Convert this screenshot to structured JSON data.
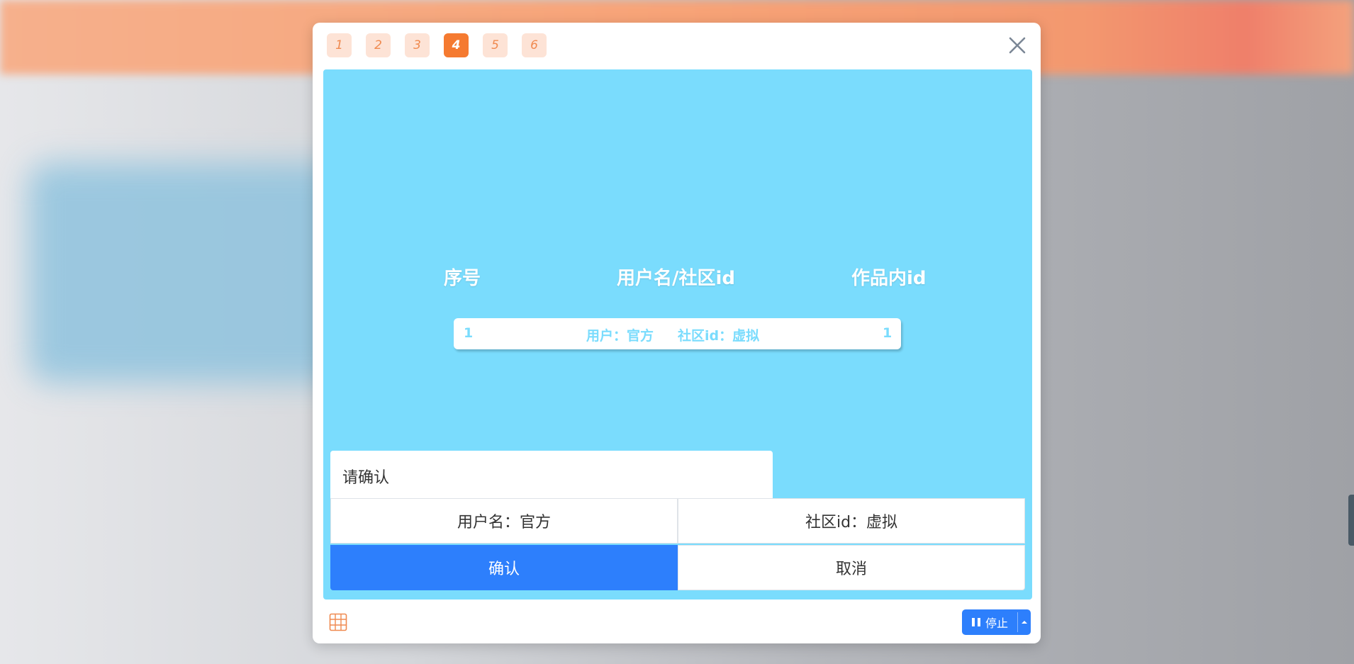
{
  "page_tabs": [
    "1",
    "2",
    "3",
    "4",
    "5",
    "6"
  ],
  "active_tab": "4",
  "table": {
    "headers": [
      "序号",
      "用户名/社区id",
      "作品内id"
    ],
    "rows": [
      {
        "index": "1",
        "user": "用户：官方",
        "community": "社区id：虚拟",
        "work_id": "1"
      }
    ]
  },
  "confirm_dialog": {
    "title": "请确认",
    "username": "用户名：官方",
    "community_id": "社区id：虚拟",
    "confirm_label": "确认",
    "cancel_label": "取消"
  },
  "player": {
    "stop_label": "停止"
  },
  "colors": {
    "accent": "#2d7ffc",
    "tab_active": "#f57a30",
    "tab_inactive": "#fde3d6",
    "stage_bg": "#7adcfd"
  },
  "icons": [
    "close-icon",
    "grid-icon",
    "pause-icon",
    "caret-up-icon"
  ]
}
